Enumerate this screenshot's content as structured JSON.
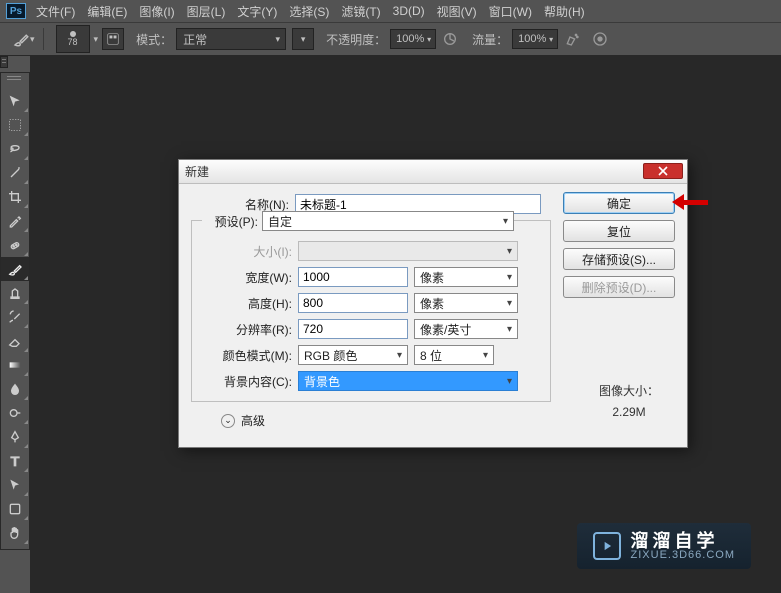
{
  "menubar": {
    "items": [
      "文件(F)",
      "编辑(E)",
      "图像(I)",
      "图层(L)",
      "文字(Y)",
      "选择(S)",
      "滤镜(T)",
      "3D(D)",
      "视图(V)",
      "窗口(W)",
      "帮助(H)"
    ]
  },
  "optionsbar": {
    "brush_size": "78",
    "mode_label": "模式：",
    "mode_value": "正常",
    "opacity_label": "不透明度：",
    "opacity_value": "100%",
    "flow_label": "流量：",
    "flow_value": "100%"
  },
  "dialog": {
    "title": "新建",
    "name_label": "名称(N):",
    "name_value": "未标题-1",
    "preset_label": "预设(P):",
    "preset_value": "自定",
    "size_label": "大小(I):",
    "size_value": "",
    "width_label": "宽度(W):",
    "width_value": "1000",
    "width_unit": "像素",
    "height_label": "高度(H):",
    "height_value": "800",
    "height_unit": "像素",
    "res_label": "分辨率(R):",
    "res_value": "720",
    "res_unit": "像素/英寸",
    "color_label": "颜色模式(M):",
    "color_value": "RGB 颜色",
    "bit_value": "8 位",
    "bg_label": "背景内容(C):",
    "bg_value": "背景色",
    "advanced_label": "高级",
    "imgsize_label": "图像大小：",
    "imgsize_value": "2.29M",
    "buttons": {
      "ok": "确定",
      "reset": "复位",
      "save_preset": "存储预设(S)...",
      "delete_preset": "删除预设(D)..."
    }
  },
  "watermark": {
    "cn": "溜溜自学",
    "url": "ZIXUE.3D66.COM"
  }
}
